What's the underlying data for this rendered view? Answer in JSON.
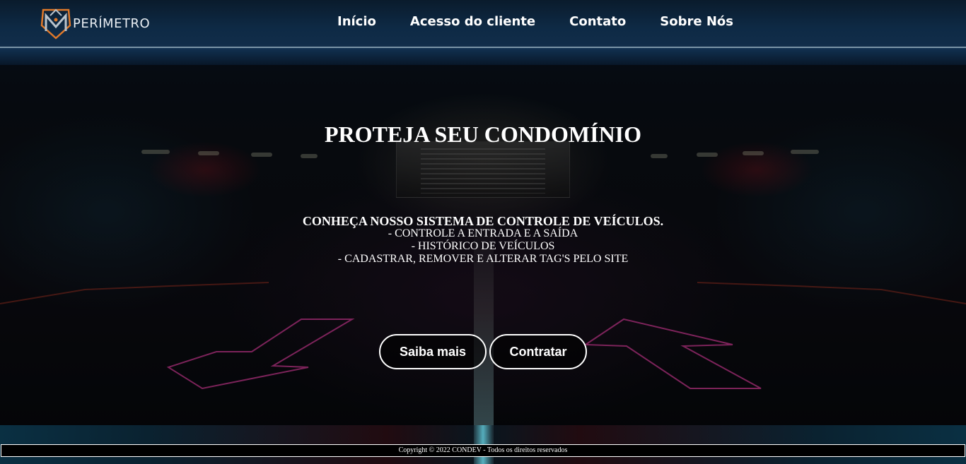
{
  "brand": {
    "name": "PERÍMETRO",
    "logo_icon": "shield-m-logo-icon",
    "colors": {
      "logo_orange": "#e0792a",
      "logo_steel": "#b9c3cc"
    }
  },
  "nav": {
    "items": [
      {
        "label": "Início"
      },
      {
        "label": "Acesso do cliente"
      },
      {
        "label": "Contato"
      },
      {
        "label": "Sobre Nós"
      }
    ]
  },
  "hero": {
    "title": "PROTEJA SEU CONDOMÍNIO",
    "lead": "CONHEÇA NOSSO SISTEMA DE CONTROLE DE VEÍCULOS.",
    "features": [
      "- CONTROLE A ENTRADA E A SAÍDA",
      "- HISTÓRICO DE VEÍCULOS",
      "- CADASTRAR, REMOVER E ALTERAR TAG'S PELO SITE"
    ],
    "buttons": {
      "learn_more": "Saiba mais",
      "hire": "Contratar"
    }
  },
  "footer": {
    "copyright": "Copyright © 2022 CONDEV - Todos os direitos reservados"
  },
  "theme": {
    "header_bg": "#0e2a45",
    "neon_arrow": "#b0307a",
    "floor_cyan": "#59c6d8"
  }
}
